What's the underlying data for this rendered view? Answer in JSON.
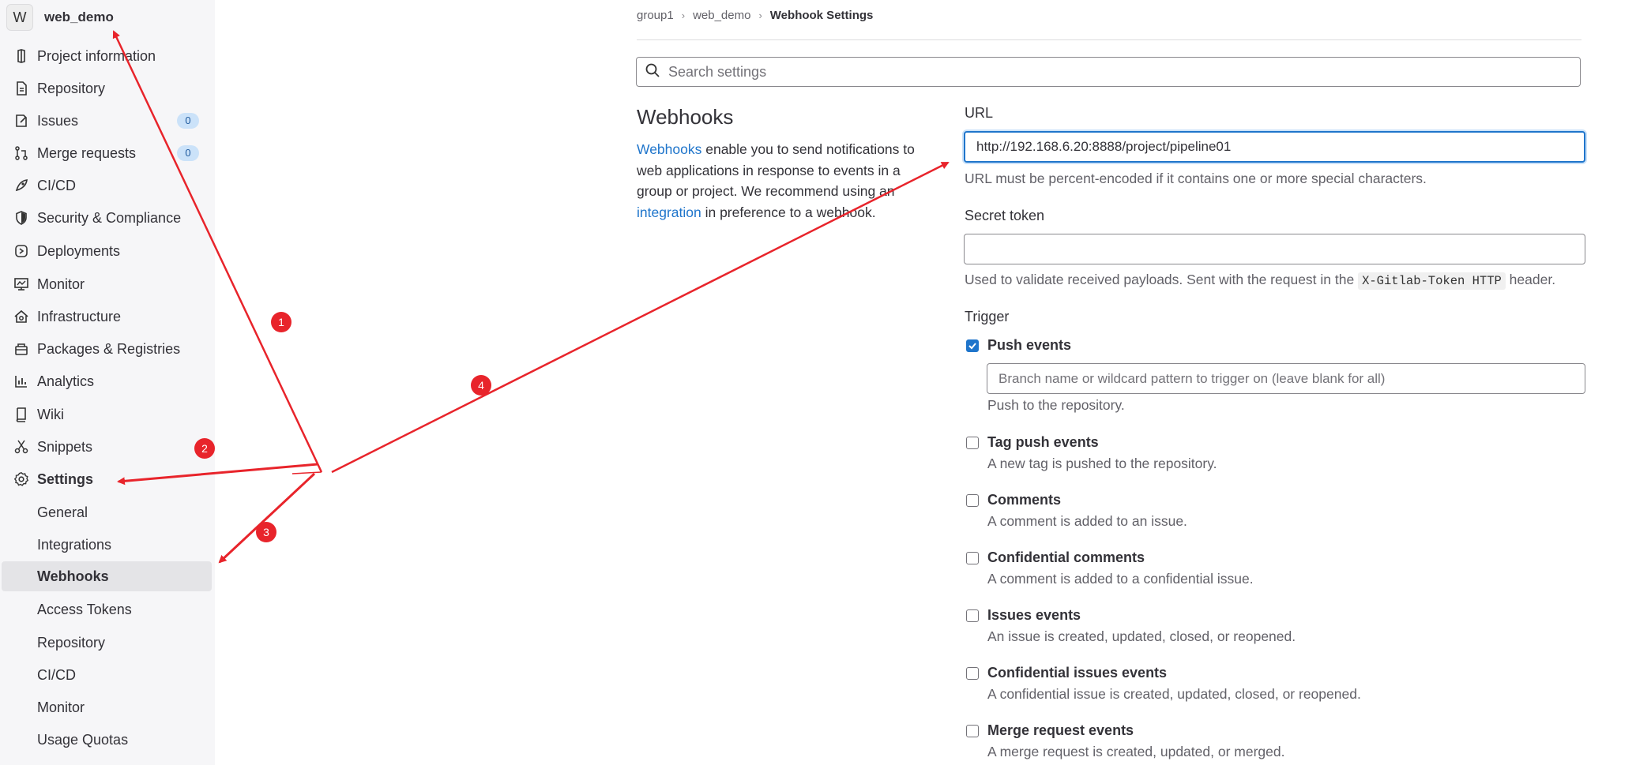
{
  "sidebar": {
    "project_avatar": "W",
    "project_name": "web_demo",
    "items": [
      {
        "label": "Project information",
        "icon": "project-info-icon"
      },
      {
        "label": "Repository",
        "icon": "document-icon"
      },
      {
        "label": "Issues",
        "icon": "issues-icon",
        "badge": "0"
      },
      {
        "label": "Merge requests",
        "icon": "merge-request-icon",
        "badge": "0"
      },
      {
        "label": "CI/CD",
        "icon": "rocket-icon"
      },
      {
        "label": "Security & Compliance",
        "icon": "shield-icon"
      },
      {
        "label": "Deployments",
        "icon": "deployments-icon"
      },
      {
        "label": "Monitor",
        "icon": "monitor-icon"
      },
      {
        "label": "Infrastructure",
        "icon": "cloud-gear-icon"
      },
      {
        "label": "Packages & Registries",
        "icon": "package-icon"
      },
      {
        "label": "Analytics",
        "icon": "chart-icon"
      },
      {
        "label": "Wiki",
        "icon": "book-icon"
      },
      {
        "label": "Snippets",
        "icon": "scissors-icon"
      },
      {
        "label": "Settings",
        "icon": "gear-icon"
      }
    ],
    "settings_sub": [
      {
        "label": "General"
      },
      {
        "label": "Integrations"
      },
      {
        "label": "Webhooks",
        "active": true
      },
      {
        "label": "Access Tokens"
      },
      {
        "label": "Repository"
      },
      {
        "label": "CI/CD"
      },
      {
        "label": "Monitor"
      },
      {
        "label": "Usage Quotas"
      }
    ]
  },
  "breadcrumb": {
    "group": "group1",
    "project": "web_demo",
    "current": "Webhook Settings"
  },
  "search": {
    "placeholder": "Search settings",
    "icon": "search-icon"
  },
  "section": {
    "title": "Webhooks",
    "desc_link1": "Webhooks",
    "desc_text1": " enable you to send notifications to web applications in response to events in a group or project. We recommend using an ",
    "desc_link2": "integration",
    "desc_text2": " in preference to a webhook."
  },
  "form": {
    "url_label": "URL",
    "url_value": "http://192.168.6.20:8888/project/pipeline01",
    "url_help": "URL must be percent-encoded if it contains one or more special characters.",
    "token_label": "Secret token",
    "token_value": "",
    "token_help_before": "Used to validate received payloads. Sent with the request in the ",
    "token_help_code": "X-Gitlab-Token HTTP",
    "token_help_after": " header.",
    "trigger_label": "Trigger",
    "push_branch_placeholder": "Branch name or wildcard pattern to trigger on (leave blank for all)",
    "triggers": [
      {
        "title": "Push events",
        "desc": "Push to the repository.",
        "checked": true
      },
      {
        "title": "Tag push events",
        "desc": "A new tag is pushed to the repository.",
        "checked": false
      },
      {
        "title": "Comments",
        "desc": "A comment is added to an issue.",
        "checked": false
      },
      {
        "title": "Confidential comments",
        "desc": "A comment is added to a confidential issue.",
        "checked": false
      },
      {
        "title": "Issues events",
        "desc": "An issue is created, updated, closed, or reopened.",
        "checked": false
      },
      {
        "title": "Confidential issues events",
        "desc": "A confidential issue is created, updated, closed, or reopened.",
        "checked": false
      },
      {
        "title": "Merge request events",
        "desc": "A merge request is created, updated, or merged.",
        "checked": false
      }
    ]
  },
  "annotations": {
    "color": "#e8242b",
    "markers": [
      "1",
      "2",
      "3",
      "4"
    ]
  },
  "colors": {
    "accent": "#1f75cb",
    "sidebar_bg": "#f6f6f8",
    "badge_bg": "#cbe2f9"
  }
}
